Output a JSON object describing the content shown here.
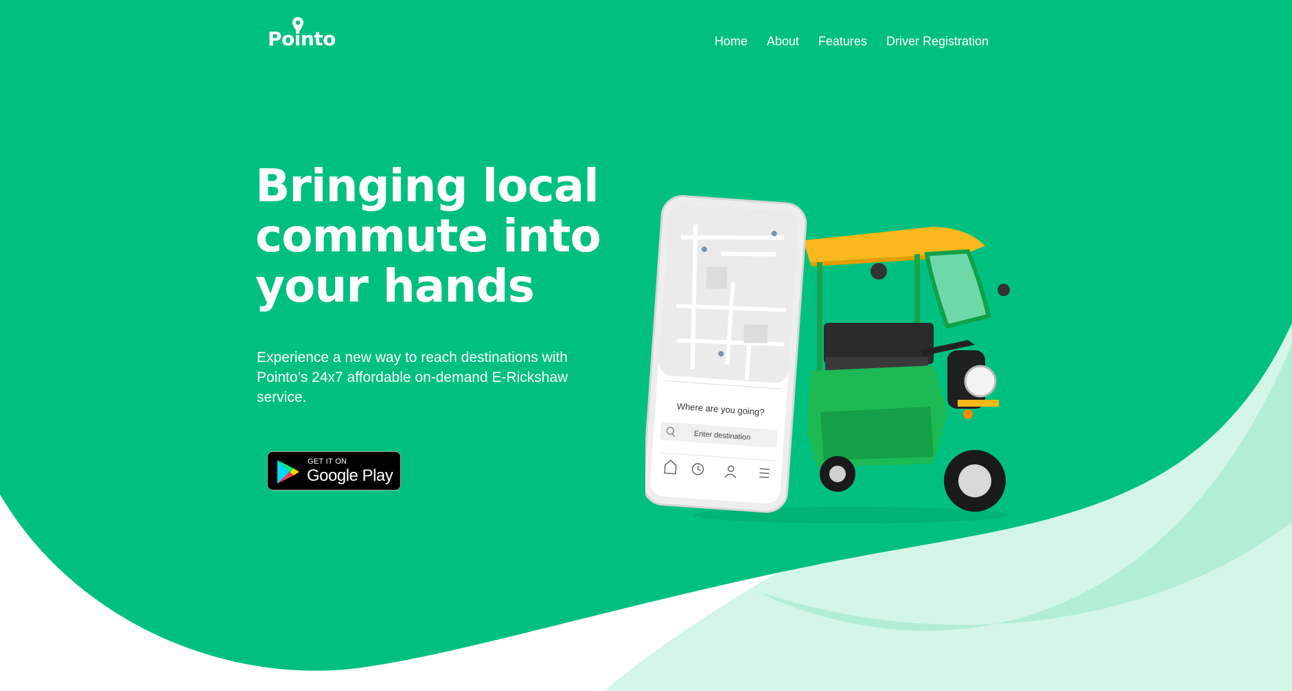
{
  "brand": {
    "name": "Pointo",
    "color_primary": "#00c07f",
    "color_light": "#c9f3e0"
  },
  "nav": {
    "items": [
      {
        "label": "Home"
      },
      {
        "label": "About"
      },
      {
        "label": "Features"
      },
      {
        "label": "Driver Registration"
      }
    ]
  },
  "hero": {
    "headline": "Bringing local commute into your hands",
    "subtext": "Experience a new way to reach destinations with Pointo’s 24x7 affordable on-demand E-Rickshaw service.",
    "store_badge": {
      "small": "GET IT ON",
      "big": "Google Play"
    }
  },
  "phone": {
    "prompt": "Where are you going?",
    "search_placeholder": "Enter destination",
    "tab_icons": [
      "home-icon",
      "history-icon",
      "profile-icon",
      "menu-icon"
    ]
  }
}
